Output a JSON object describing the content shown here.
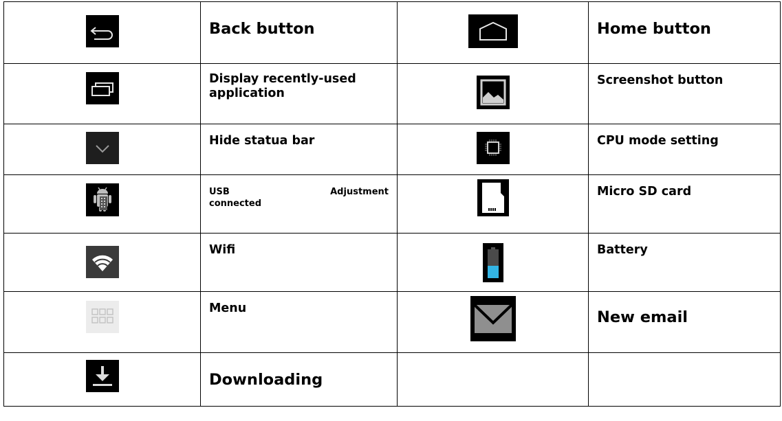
{
  "rows": [
    {
      "left_icon": "back-arrow-icon",
      "left_label": "Back button",
      "right_icon": "home-icon",
      "right_label": "Home button"
    },
    {
      "left_icon": "recent-apps-icon",
      "left_label": "Display recently-used application",
      "right_icon": "screenshot-icon",
      "right_label": "Screenshot button"
    },
    {
      "left_icon": "chevron-down-icon",
      "left_label": "Hide statua bar",
      "right_icon": "cpu-icon",
      "right_label": "CPU mode setting"
    },
    {
      "left_icon": "android-usb-icon",
      "left_label_parts": [
        "USB",
        "Adjustment"
      ],
      "left_label_line2": "connected",
      "right_icon": "micro-sd-card-icon",
      "right_label": "Micro SD card"
    },
    {
      "left_icon": "wifi-icon",
      "left_label": "Wifi",
      "right_icon": "battery-icon",
      "right_label": "Battery"
    },
    {
      "left_icon": "menu-grid-icon",
      "left_label": "Menu",
      "right_icon": "email-icon",
      "right_label": "New email"
    },
    {
      "left_icon": "download-icon",
      "left_label": "Downloading",
      "right_icon": "",
      "right_label": ""
    }
  ],
  "colors": {
    "icon_bg": "#000000",
    "battery_fill": "#33b5e5",
    "icon_grey": "#cfcfcf"
  }
}
